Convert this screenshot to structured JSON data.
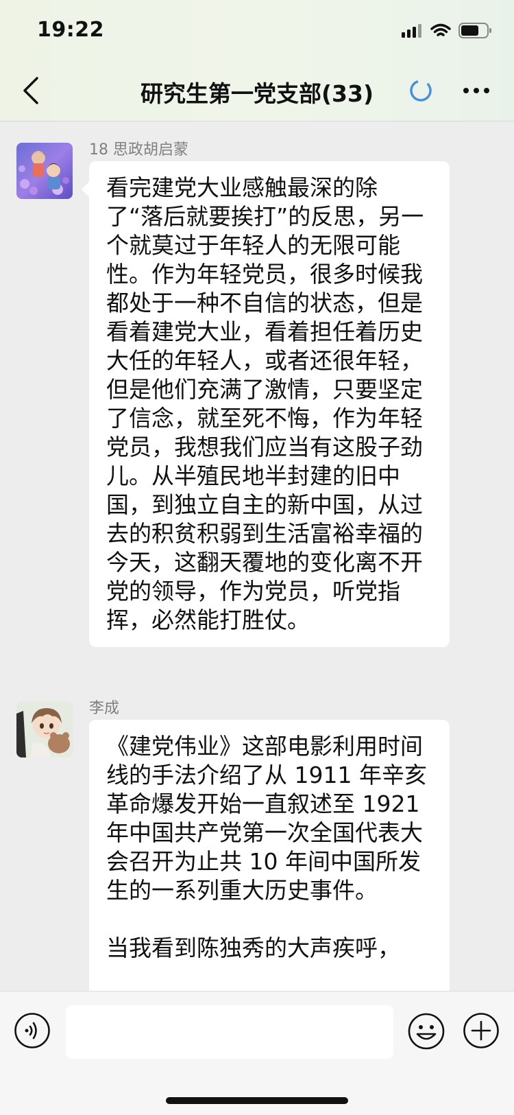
{
  "status_bar": {
    "time": "19:22"
  },
  "header": {
    "title": "研究生第一党支部(33)"
  },
  "messages": [
    {
      "sender": "18 思政胡启蒙",
      "avatar": "anime-couple-flowers-avatar",
      "text": "看完建党大业感触最深的除了“落后就要挨打”的反思，另一个就莫过于年轻人的无限可能性。作为年轻党员，很多时候我都处于一种不自信的状态，但是看着建党大业，看着担任着历史大任的年轻人，或者还很年轻，但是他们充满了激情，只要坚定了信念，就至死不悔，作为年轻党员，我想我们应当有这股子劲儿。从半殖民地半封建的旧中国，到独立自主的新中国，从过去的积贫积弱到生活富裕幸福的今天，这翻天覆地的变化离不开党的领导，作为党员，听党指挥，必然能打胜仗。"
    },
    {
      "sender": "李成",
      "avatar": "anime-boy-with-bear-avatar",
      "text": "《建党伟业》这部电影利用时间线的手法介绍了从 1911 年辛亥革命爆发开始一直叙述至 1921 年中国共产党第一次全国代表大会召开为止共 10 年间中国所发生的一系列重大历史事件。\n\n当我看到陈独秀的大声疾呼，"
    }
  ],
  "input_bar": {
    "placeholder": "",
    "voice_icon": "voice-input-icon",
    "emoji_icon": "emoji-icon",
    "plus_icon": "plus-icon"
  },
  "colors": {
    "background": "#ededed",
    "bubble": "#ffffff",
    "spinner": "#4a90d9"
  }
}
